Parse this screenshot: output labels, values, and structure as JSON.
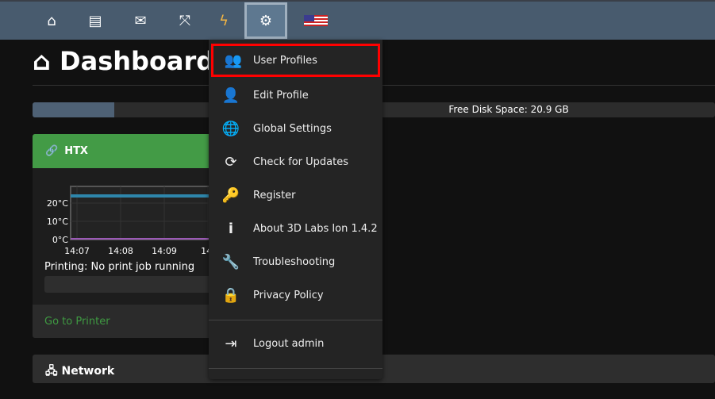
{
  "nav": {
    "items": [
      {
        "name": "home-icon",
        "glyph": "⌂"
      },
      {
        "name": "archive-icon",
        "glyph": "▤"
      },
      {
        "name": "mail-icon",
        "glyph": "✉"
      },
      {
        "name": "fullscreen-icon",
        "glyph": "⤧"
      },
      {
        "name": "lightning-icon",
        "glyph": "ϟ"
      },
      {
        "name": "gear-icon",
        "glyph": "⚙"
      }
    ],
    "flag": "us-flag-icon"
  },
  "page": {
    "title": "Dashboard"
  },
  "disk": {
    "label": "Free Disk Space: 20.9 GB",
    "used_fraction": 0.12
  },
  "printer": {
    "name": "HTX",
    "status": "Printing: No print job running",
    "link": "Go to Printer",
    "chart": {
      "yticks": [
        "20°C",
        "10°C",
        "0°C"
      ],
      "xticks": [
        "14:07",
        "14:08",
        "14:09",
        "14:"
      ],
      "series": [
        {
          "color": "#2e86ab",
          "value": 24
        },
        {
          "color": "#9b59b6",
          "value": 0
        }
      ]
    }
  },
  "network": {
    "title": "Network"
  },
  "menu": {
    "items": [
      {
        "label": "User Profiles",
        "icon": "users-icon",
        "glyph": "👥"
      },
      {
        "label": "Edit Profile",
        "icon": "user-icon",
        "glyph": "👤"
      },
      {
        "label": "Global Settings",
        "icon": "globe-icon",
        "glyph": "🌐"
      },
      {
        "label": "Check for Updates",
        "icon": "refresh-icon",
        "glyph": "⟳"
      },
      {
        "label": "Register",
        "icon": "key-icon",
        "glyph": "🔑"
      },
      {
        "label": "About 3D Labs Ion 1.4.2",
        "icon": "info-icon",
        "glyph": "i"
      },
      {
        "label": "Troubleshooting",
        "icon": "wrench-icon",
        "glyph": "🔧"
      },
      {
        "label": "Privacy Policy",
        "icon": "lock-icon",
        "glyph": "🔒"
      }
    ],
    "logout": {
      "label": "Logout admin",
      "icon": "logout-icon",
      "glyph": "⇥"
    }
  }
}
